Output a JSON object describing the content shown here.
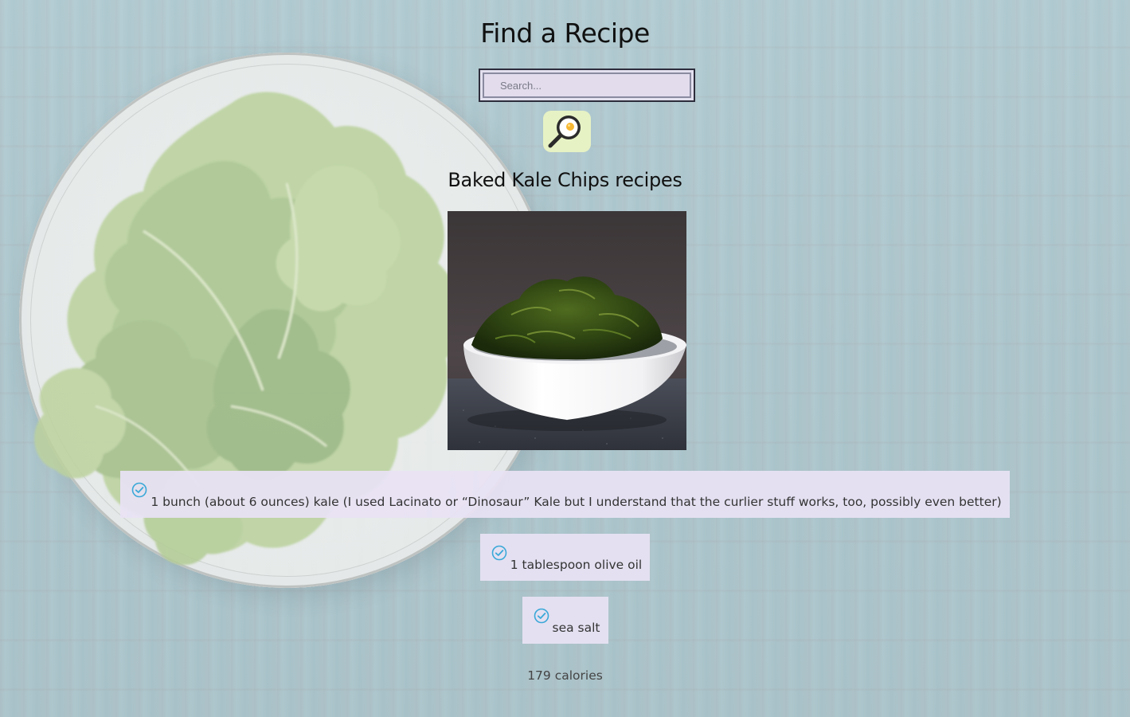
{
  "header": {
    "title": "Find a Recipe"
  },
  "search": {
    "placeholder": "Search...",
    "value": "",
    "button_icon": "frying-pan-egg-magnifier-icon"
  },
  "recipe": {
    "title": "Baked Kale Chips recipes",
    "image_icon": "kale-chips-bowl-image",
    "ingredients": [
      "1 bunch (about 6 ounces) kale (I used Lacinato or “Dinosaur” Kale but I understand that the curlier stuff works, too, possibly even better)",
      "1 tablespoon olive oil",
      "sea salt"
    ],
    "ingredient_icon": "check-circle-icon",
    "calories": "179 calories"
  },
  "colors": {
    "background": "#8fb3bd",
    "search_button_bg": "#e6f2c4",
    "ingredient_bg": "#e8e2f4",
    "check_icon": "#3aa8d8"
  }
}
